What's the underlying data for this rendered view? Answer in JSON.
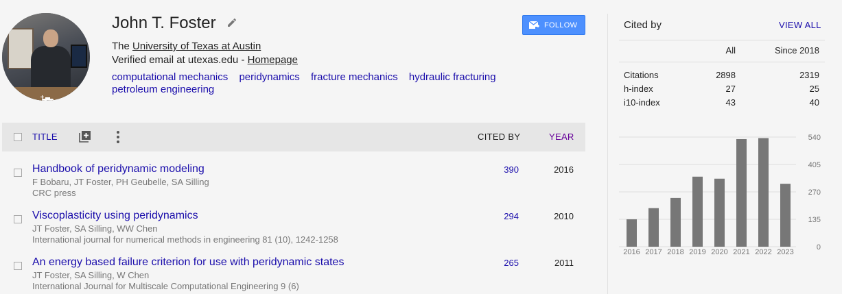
{
  "profile": {
    "name": "John T. Foster",
    "affiliation_prefix": "The ",
    "affiliation_link": "University of Texas at Austin",
    "email_text": "Verified email at utexas.edu - ",
    "homepage_label": "Homepage",
    "interests": [
      "computational mechanics",
      "peridynamics",
      "fracture mechanics",
      "hydraulic fracturing",
      "petroleum engineering"
    ],
    "follow_label": "FOLLOW"
  },
  "table": {
    "title_header": "TITLE",
    "cited_header": "CITED BY",
    "year_header": "YEAR",
    "rows": [
      {
        "title": "Handbook of peridynamic modeling",
        "authors": "F Bobaru, JT Foster, PH Geubelle, SA Silling",
        "venue": "CRC press",
        "cited": "390",
        "year": "2016"
      },
      {
        "title": "Viscoplasticity using peridynamics",
        "authors": "JT Foster, SA Silling, WW Chen",
        "venue": "International journal for numerical methods in engineering 81 (10), 1242-1258",
        "cited": "294",
        "year": "2010"
      },
      {
        "title": "An energy based failure criterion for use with peridynamic states",
        "authors": "JT Foster, SA Silling, W Chen",
        "venue": "International Journal for Multiscale Computational Engineering 9 (6)",
        "cited": "265",
        "year": "2011"
      }
    ]
  },
  "cited_by": {
    "title": "Cited by",
    "view_all": "VIEW ALL",
    "col_all": "All",
    "col_since": "Since 2018",
    "metrics": [
      {
        "label": "Citations",
        "all": "2898",
        "since": "2319"
      },
      {
        "label": "h-index",
        "all": "27",
        "since": "25"
      },
      {
        "label": "i10-index",
        "all": "43",
        "since": "40"
      }
    ]
  },
  "chart_data": {
    "type": "bar",
    "categories": [
      "2016",
      "2017",
      "2018",
      "2019",
      "2020",
      "2021",
      "2022",
      "2023"
    ],
    "values": [
      135,
      190,
      240,
      345,
      335,
      530,
      535,
      310
    ],
    "ylim": [
      0,
      540
    ],
    "yticks": [
      "540",
      "405",
      "270",
      "135",
      "0"
    ],
    "bar_color": "#777777",
    "grid": true
  },
  "colors": {
    "link": "#1a0dab",
    "follow": "#4d90fe",
    "year_header": "#660099"
  }
}
